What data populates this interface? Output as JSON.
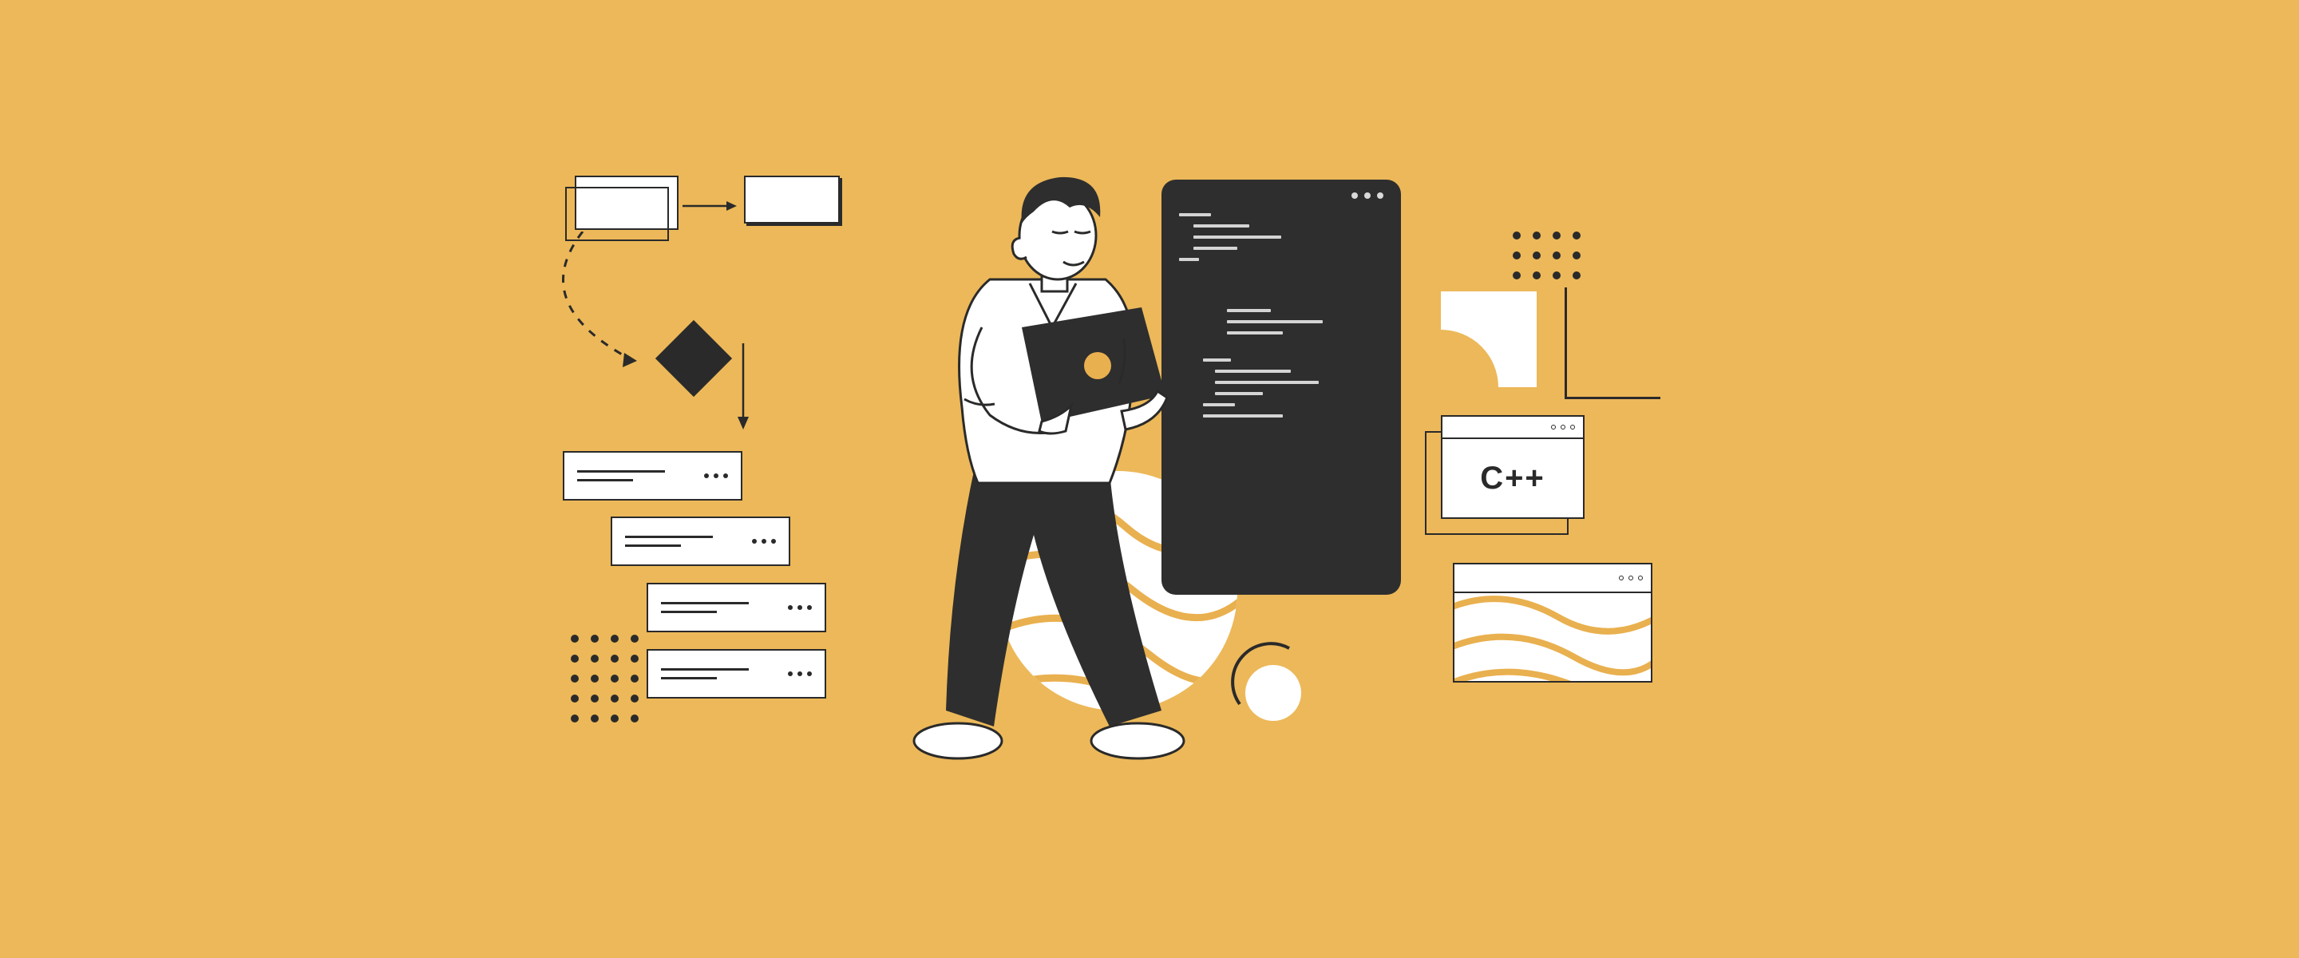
{
  "illustration": {
    "description": "Flat vector illustration of a developer holding a laptop surrounded by programming and flowchart graphics",
    "palette": {
      "background": "#ecb859",
      "ink": "#2a2a2a",
      "paper": "#ffffff",
      "accent": "#e9b04f"
    },
    "cpp_window": {
      "label": "C++"
    },
    "elements": [
      "flowchart-boxes",
      "flowchart-diamond",
      "dashed-arrow",
      "stacked-list-cards",
      "dot-grid-left",
      "dot-grid-right",
      "code-editor-panel",
      "person-with-laptop",
      "wavy-sphere",
      "small-circle-with-arc",
      "cpp-browser-window",
      "wavy-texture-card",
      "quarter-circle-cutout",
      "angle-bracket-shape"
    ]
  }
}
